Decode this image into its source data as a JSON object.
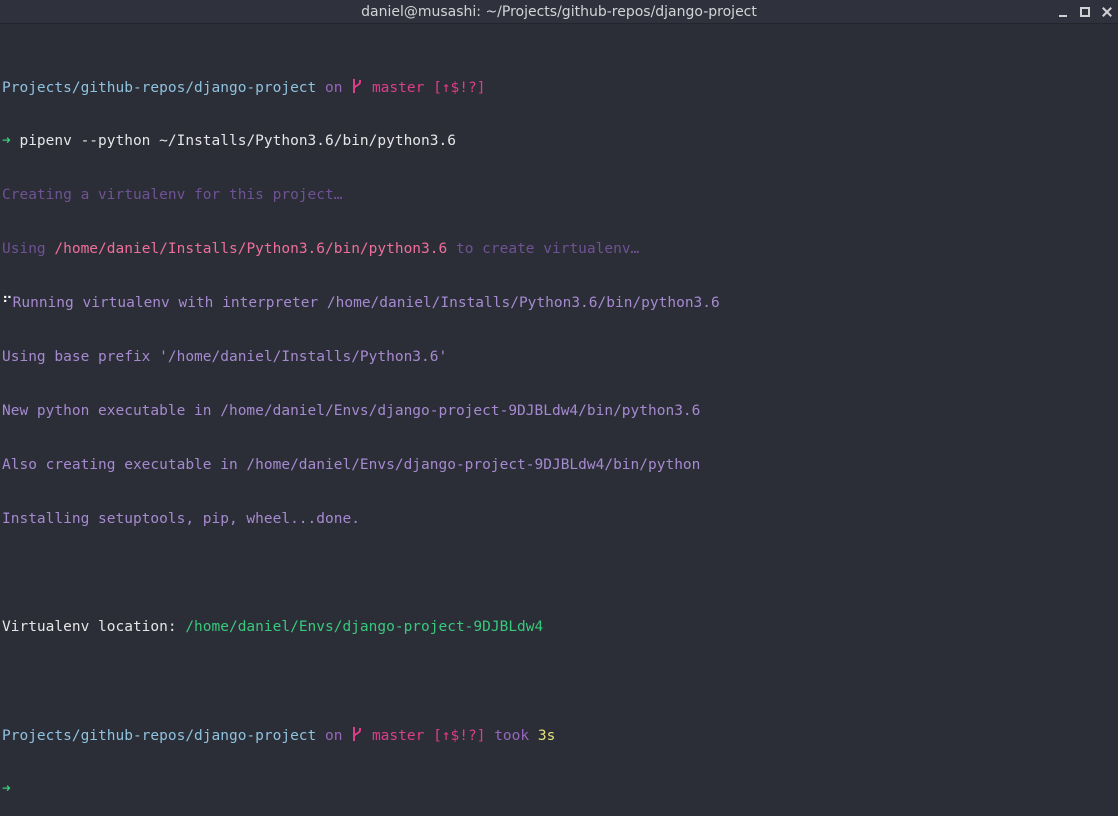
{
  "window": {
    "title": "daniel@musashi: ~/Projects/github-repos/django-project"
  },
  "colors": {
    "background": "#2b2d37",
    "path": "#8fc2df",
    "on": "#9767bd",
    "branch": "#dc3f8a",
    "output": "#a68ad0",
    "arrow": "#38c97c",
    "duration": "#e3e27a"
  },
  "prompt1": {
    "path": "Projects/github-repos/django-project",
    "on": "on",
    "branch": "master",
    "status": "[↑$!?]"
  },
  "command": {
    "arrow": "➜",
    "text": "pipenv --python ~/Installs/Python3.6/bin/python3.6"
  },
  "output": {
    "line1": "Creating a virtualenv for this project…",
    "line2_prefix": "Using ",
    "line2_path": "/home/daniel/Installs/Python3.6/bin/python3.6",
    "line2_suffix": " to create virtualenv…",
    "line3_mark": "⠋",
    "line3_text": "Running virtualenv with interpreter /home/daniel/Installs/Python3.6/bin/python3.6",
    "line4": "Using base prefix '/home/daniel/Installs/Python3.6'",
    "line5": "New python executable in /home/daniel/Envs/django-project-9DJBLdw4/bin/python3.6",
    "line6": "Also creating executable in /home/daniel/Envs/django-project-9DJBLdw4/bin/python",
    "line7": "Installing setuptools, pip, wheel...done.",
    "location_label": "Virtualenv location: ",
    "location_path": "/home/daniel/Envs/django-project-9DJBLdw4"
  },
  "prompt2": {
    "path": "Projects/github-repos/django-project",
    "on": "on",
    "branch": "master",
    "status": "[↑$!?]",
    "took": "took",
    "duration": "3s"
  },
  "prompt3": {
    "arrow": "➜"
  }
}
